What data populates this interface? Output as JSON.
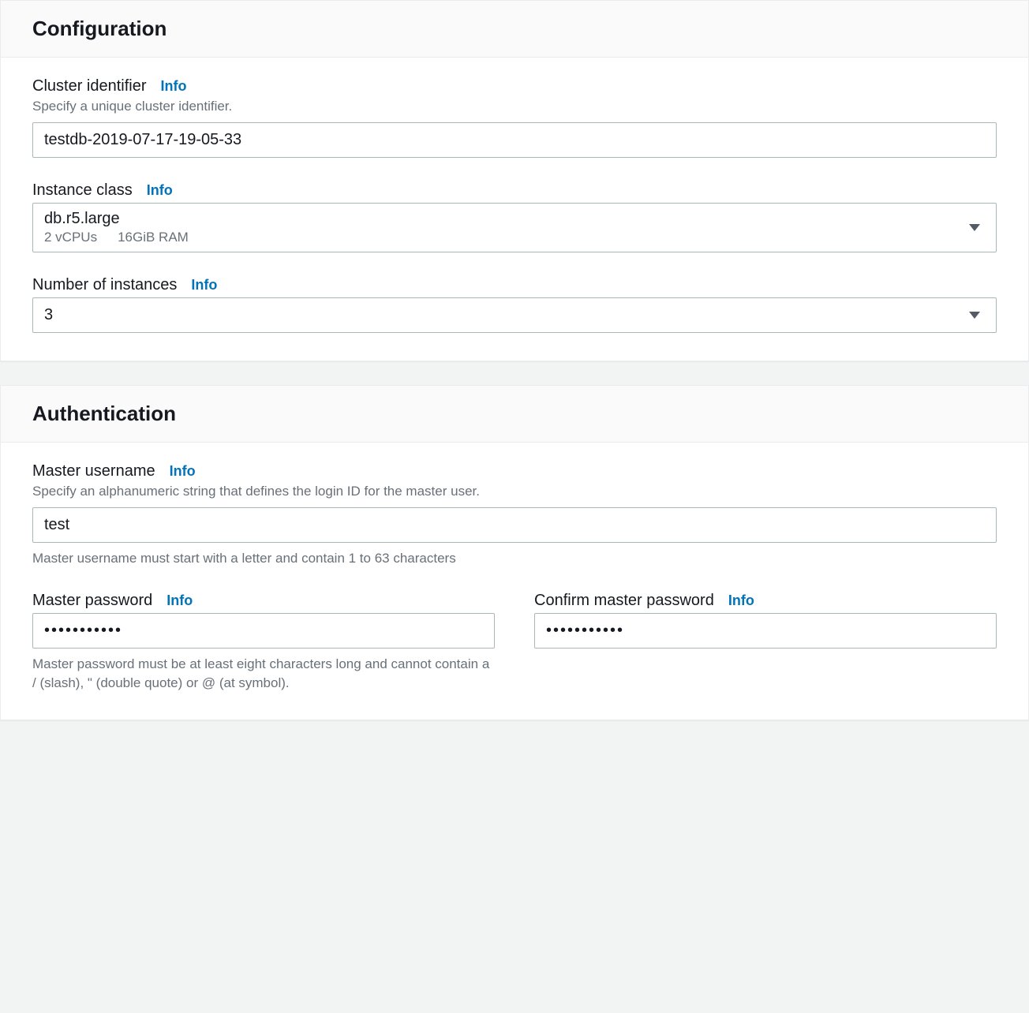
{
  "configuration": {
    "title": "Configuration",
    "cluster_identifier": {
      "label": "Cluster identifier",
      "info": "Info",
      "description": "Specify a unique cluster identifier.",
      "value": "testdb-2019-07-17-19-05-33"
    },
    "instance_class": {
      "label": "Instance class",
      "info": "Info",
      "selected": "db.r5.large",
      "vcpus": "2 vCPUs",
      "ram": "16GiB RAM"
    },
    "number_of_instances": {
      "label": "Number of instances",
      "info": "Info",
      "selected": "3"
    }
  },
  "authentication": {
    "title": "Authentication",
    "master_username": {
      "label": "Master username",
      "info": "Info",
      "description": "Specify an alphanumeric string that defines the login ID for the master user.",
      "value": "test",
      "hint": "Master username must start with a letter and contain 1 to 63 characters"
    },
    "master_password": {
      "label": "Master password",
      "info": "Info",
      "value": "•••••••••••",
      "hint": "Master password must be at least eight characters long and cannot contain a / (slash), \" (double quote) or @ (at symbol)."
    },
    "confirm_master_password": {
      "label": "Confirm master password",
      "info": "Info",
      "value": "•••••••••••"
    }
  }
}
